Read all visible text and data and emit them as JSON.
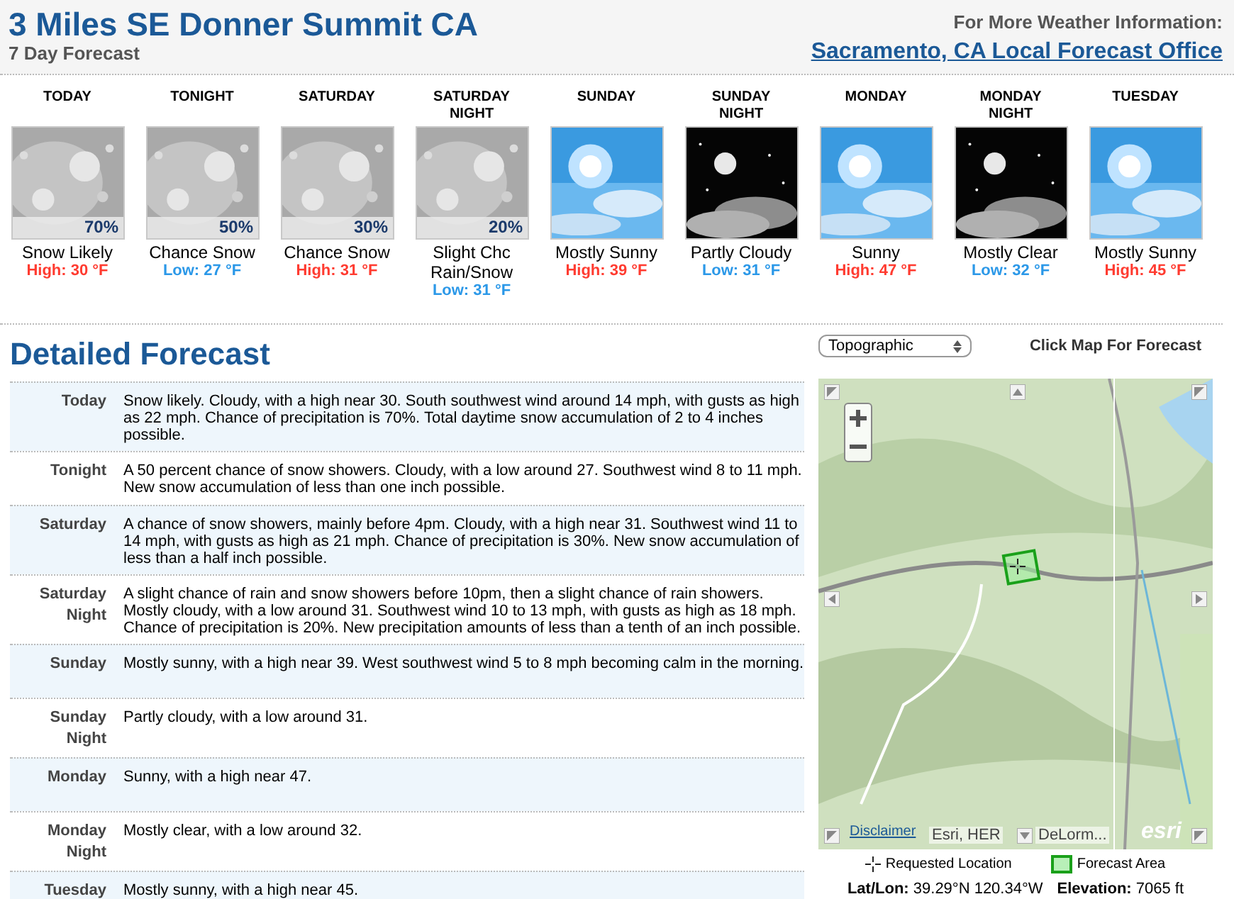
{
  "header": {
    "title": "3 Miles SE Donner Summit CA",
    "subtitle": "7 Day Forecast",
    "info_label": "For More Weather Information:",
    "office_link": "Sacramento, CA Local Forecast Office"
  },
  "periods": [
    {
      "name": "TODAY",
      "kind": "picture",
      "chance": "70%",
      "short": "Snow Likely",
      "temp": "High: 30 °F",
      "color": "#ff3b30"
    },
    {
      "name": "TONIGHT",
      "kind": "picture",
      "chance": "50%",
      "short": "Chance Snow",
      "temp": "Low: 27 °F",
      "color": "#2b98e8"
    },
    {
      "name": "SATURDAY",
      "kind": "picture",
      "chance": "30%",
      "short": "Chance Snow",
      "temp": "High: 31 °F",
      "color": "#ff3b30"
    },
    {
      "name": "SATURDAY NIGHT",
      "kind": "picture",
      "chance": "20%",
      "short": "Slight Chc Rain/Snow",
      "temp": "Low: 31 °F",
      "color": "#2b98e8"
    },
    {
      "name": "SUNDAY",
      "kind": "picture",
      "short": "Mostly Sunny",
      "temp": "High: 39 °F",
      "color": "#ff3b30"
    },
    {
      "name": "SUNDAY NIGHT",
      "kind": "picture",
      "short": "Partly Cloudy",
      "temp": "Low: 31 °F",
      "color": "#2b98e8"
    },
    {
      "name": "MONDAY",
      "kind": "picture",
      "short": "Sunny",
      "temp": "High: 47 °F",
      "color": "#ff3b30"
    },
    {
      "name": "MONDAY NIGHT",
      "kind": "picture",
      "short": "Mostly Clear",
      "temp": "Low: 32 °F",
      "color": "#2b98e8"
    },
    {
      "name": "TUESDAY",
      "kind": "picture",
      "short": "Mostly Sunny",
      "temp": "High: 45 °F",
      "color": "#ff3b30"
    }
  ],
  "detailed": {
    "title": "Detailed Forecast",
    "rows": [
      {
        "label": "Today",
        "text": "Snow likely. Cloudy, with a high near 30. South southwest wind around 14 mph, with gusts as high as 22 mph. Chance of precipitation is 70%. Total daytime snow accumulation of 2 to 4 inches possible."
      },
      {
        "label": "Tonight",
        "text": "A 50 percent chance of snow showers. Cloudy, with a low around 27. Southwest wind 8 to 11 mph. New snow accumulation of less than one inch possible."
      },
      {
        "label": "Saturday",
        "text": "A chance of snow showers, mainly before 4pm. Cloudy, with a high near 31. Southwest wind 11 to 14 mph, with gusts as high as 21 mph. Chance of precipitation is 30%. New snow accumulation of less than a half inch possible."
      },
      {
        "label": "Saturday Night",
        "text": "A slight chance of rain and snow showers before 10pm, then a slight chance of rain showers. Mostly cloudy, with a low around 31. Southwest wind 10 to 13 mph, with gusts as high as 18 mph. Chance of precipitation is 20%. New precipitation amounts of less than a tenth of an inch possible."
      },
      {
        "label": "Sunday",
        "text": "Mostly sunny, with a high near 39. West southwest wind 5 to 8 mph becoming calm in the morning."
      },
      {
        "label": "Sunday Night",
        "text": "Partly cloudy, with a low around 31."
      },
      {
        "label": "Monday",
        "text": "Sunny, with a high near 47."
      },
      {
        "label": "Monday Night",
        "text": "Mostly clear, with a low around 32."
      },
      {
        "label": "Tuesday",
        "text": "Mostly sunny, with a high near 45."
      }
    ]
  },
  "map": {
    "layer_select": "Topographic",
    "hint": "Click Map For Forecast",
    "disclaimer": "Disclaimer",
    "attribution_left": "Esri, HER",
    "attribution_right": "DeLorm...",
    "logo": "esri",
    "legend": [
      {
        "kind": "crosshair",
        "label": "Requested Location"
      },
      {
        "kind": "area",
        "label": "Forecast Area"
      }
    ],
    "latlon": "**Lat/Lon:** 39.29°N 120.34°W",
    "elevation": "**Elevation:** 7065 ft"
  }
}
